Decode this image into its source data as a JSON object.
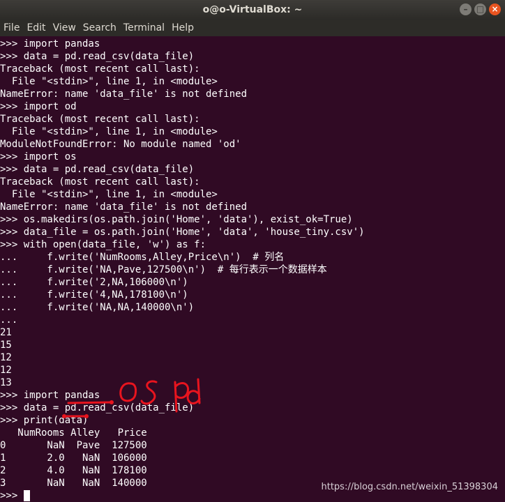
{
  "window": {
    "title": "o@o-VirtualBox: ~",
    "minimize_icon": "minimize-icon",
    "maximize_icon": "maximize-icon",
    "close_icon": "close-icon",
    "minimize_glyph": "–",
    "maximize_glyph": "□",
    "close_glyph": "×"
  },
  "menu": [
    "File",
    "Edit",
    "View",
    "Search",
    "Terminal",
    "Help"
  ],
  "terminal": {
    "lines": [
      ">>> import pandas",
      ">>> data = pd.read_csv(data_file)",
      "Traceback (most recent call last):",
      "  File \"<stdin>\", line 1, in <module>",
      "NameError: name 'data_file' is not defined",
      ">>> import od",
      "Traceback (most recent call last):",
      "  File \"<stdin>\", line 1, in <module>",
      "ModuleNotFoundError: No module named 'od'",
      ">>> import os",
      ">>> data = pd.read_csv(data_file)",
      "Traceback (most recent call last):",
      "  File \"<stdin>\", line 1, in <module>",
      "NameError: name 'data_file' is not defined",
      ">>> os.makedirs(os.path.join('Home', 'data'), exist_ok=True)",
      ">>> data_file = os.path.join('Home', 'data', 'house_tiny.csv')",
      ">>> with open(data_file, 'w') as f:",
      "...     f.write('NumRooms,Alley,Price\\n')  # 列名",
      "...     f.write('NA,Pave,127500\\n')  # 每行表示一个数据样本",
      "...     f.write('2,NA,106000\\n')",
      "...     f.write('4,NA,178100\\n')",
      "...     f.write('NA,NA,140000\\n')",
      "...",
      "21",
      "15",
      "12",
      "12",
      "13",
      ">>> import pandas",
      ">>> data = pd.read_csv(data_file)",
      ">>> print(data)",
      "   NumRooms Alley   Price",
      "0       NaN  Pave  127500",
      "1       2.0   NaN  106000",
      "2       4.0   NaN  178100",
      "3       NaN   NaN  140000"
    ],
    "prompt": ">>> "
  },
  "annotation": {
    "handwritten_text": "os pd",
    "color": "#e8141e"
  },
  "watermark": "https://blog.csdn.net/weixin_51398304",
  "colors": {
    "terminal_bg": "#300a24",
    "titlebar_bg": "#2c2b28",
    "close_button": "#e95420"
  }
}
